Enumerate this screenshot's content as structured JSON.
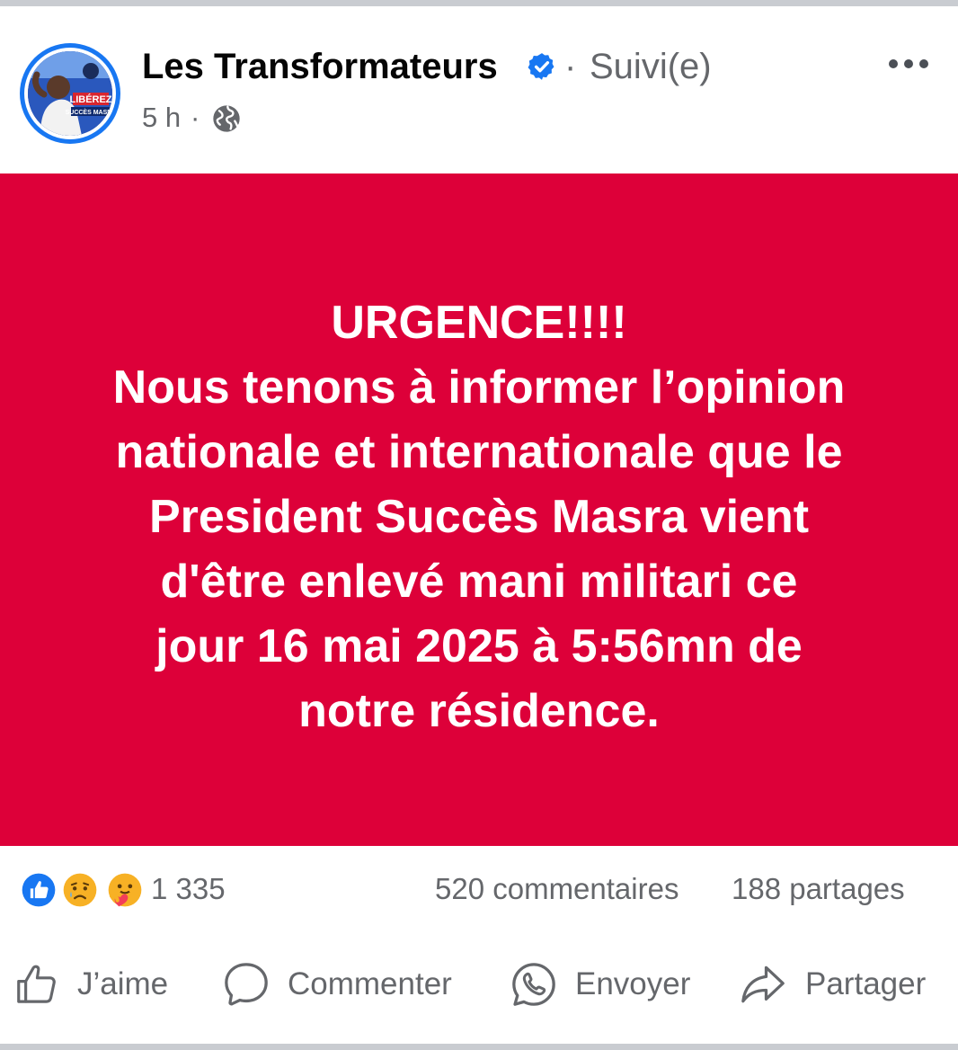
{
  "post": {
    "page_name": "Les Transformateurs",
    "separator": "·",
    "follow_status": "Suivi(e)",
    "timestamp": "5 h",
    "timestamp_separator": "·",
    "audience_icon": "globe-icon",
    "avatar_text_line1": "LIBÉREZ",
    "avatar_text_line2": "SUCCÈS MASRA",
    "body_lines": [
      "URGENCE!!!!",
      "Nous tenons à informer l’opinion",
      "nationale et internationale que le",
      "President Succès Masra vient",
      "d'être enlevé mani militari ce",
      "jour 16 mai 2025 à 5:56mn de",
      "notre résidence."
    ],
    "body_background": "#dd0039"
  },
  "stats": {
    "reaction_icons": [
      "like-icon",
      "sad-icon",
      "care-icon"
    ],
    "reactions_count": "1 335",
    "comments": "520 commentaires",
    "shares": "188 partages"
  },
  "actions": {
    "like_label": "J’aime",
    "comment_label": "Commenter",
    "send_label": "Envoyer",
    "share_label": "Partager"
  },
  "colors": {
    "accent": "#1877f2",
    "secondary_text": "#65676b",
    "primary_text": "#050505"
  }
}
